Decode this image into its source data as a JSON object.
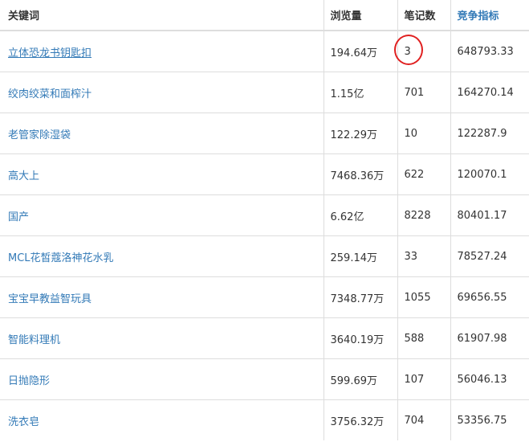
{
  "table": {
    "headers": {
      "keyword": "关键词",
      "views": "浏览量",
      "notes": "笔记数",
      "competition": "竞争指标"
    },
    "rows": [
      {
        "keyword": "立体恐龙书钥匙扣",
        "views": "194.64万",
        "notes": "3",
        "competition": "648793.33"
      },
      {
        "keyword": "绞肉绞菜和面榨汁",
        "views": "1.15亿",
        "notes": "701",
        "competition": "164270.14"
      },
      {
        "keyword": "老管家除湿袋",
        "views": "122.29万",
        "notes": "10",
        "competition": "122287.9"
      },
      {
        "keyword": "高大上",
        "views": "7468.36万",
        "notes": "622",
        "competition": "120070.1"
      },
      {
        "keyword": "国产",
        "views": "6.62亿",
        "notes": "8228",
        "competition": "80401.17"
      },
      {
        "keyword": "MCL花皙蔻洛神花水乳",
        "views": "259.14万",
        "notes": "33",
        "competition": "78527.24"
      },
      {
        "keyword": "宝宝早教益智玩具",
        "views": "7348.77万",
        "notes": "1055",
        "competition": "69656.55"
      },
      {
        "keyword": "智能料理机",
        "views": "3640.19万",
        "notes": "588",
        "competition": "61907.98"
      },
      {
        "keyword": "日抛隐形",
        "views": "599.69万",
        "notes": "107",
        "competition": "56046.13"
      },
      {
        "keyword": "洗衣皂",
        "views": "3756.32万",
        "notes": "704",
        "competition": "53356.75"
      }
    ]
  },
  "colors": {
    "link": "#337ab7",
    "annotation_circle": "#e02020",
    "border": "#dddddd"
  }
}
